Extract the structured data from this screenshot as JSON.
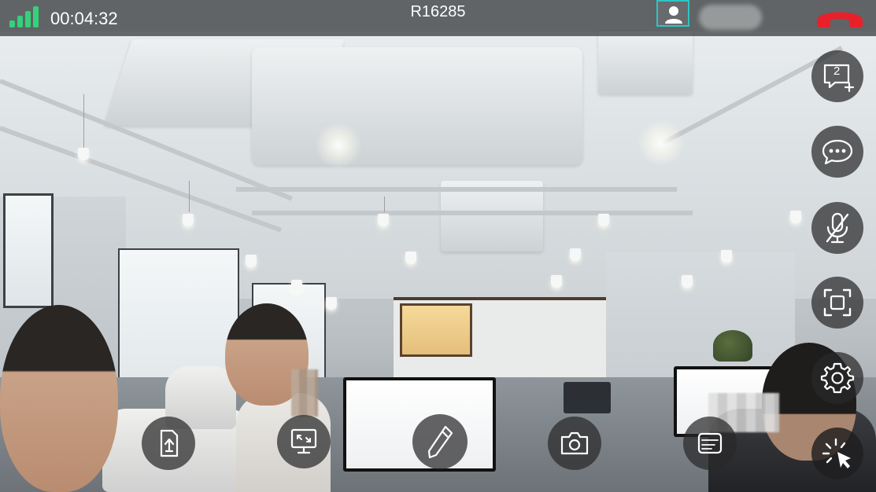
{
  "call": {
    "duration": "00:04:32",
    "room_id": "R16285"
  },
  "colors": {
    "signal": "#33d17a",
    "participant_outline": "#2ec4c4",
    "hangup": "#e8202a",
    "button_bg": "#28282a",
    "icon": "#ffffff"
  },
  "side_buttons": [
    {
      "icon": "whiteboard-add-icon",
      "badge": "2"
    },
    {
      "icon": "chat-bubble-icon"
    },
    {
      "icon": "microphone-muted-icon"
    },
    {
      "icon": "screen-capture-icon"
    },
    {
      "icon": "gear-icon"
    },
    {
      "icon": "cursor-pointer-icon"
    }
  ],
  "bottom_buttons": [
    {
      "icon": "share-file-icon"
    },
    {
      "icon": "screen-switch-icon"
    },
    {
      "icon": "pen-annotate-icon"
    },
    {
      "icon": "camera-icon"
    },
    {
      "icon": "ai-recognition-icon"
    }
  ]
}
